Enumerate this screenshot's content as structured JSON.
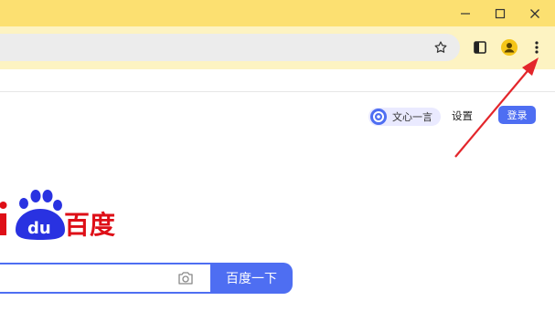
{
  "window": {
    "minimize_icon": "minimize-icon",
    "maximize_icon": "maximize-icon",
    "close_icon": "close-icon"
  },
  "toolbar": {
    "bookmark_icon": "star-icon",
    "sidepanel_icon": "side-panel-icon",
    "profile_icon": "profile-icon",
    "menu_icon": "three-dot-menu-icon"
  },
  "baidu_header": {
    "wenxin_label": "文心一言",
    "settings_label": "设置",
    "login_label": "登录"
  },
  "logo": {
    "text": "百度"
  },
  "search": {
    "button_label": "百度一下",
    "camera_icon": "camera-icon"
  },
  "colors": {
    "titlebar": "#fce071",
    "toolbar": "#fdf3c2",
    "baidu_blue": "#4e6ef2",
    "baidu_red": "#de0f17",
    "arrow": "#e3262b"
  }
}
